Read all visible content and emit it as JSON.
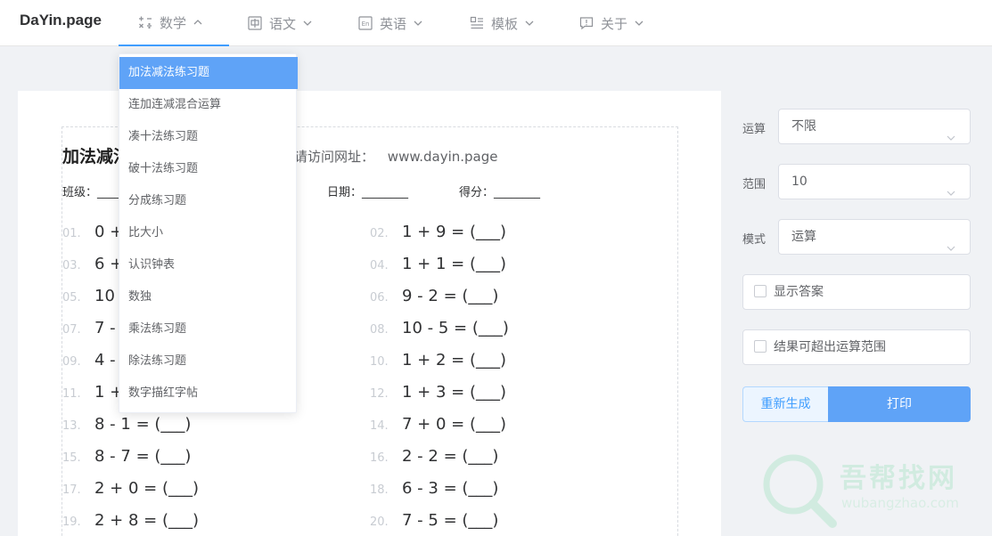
{
  "brand": "DaYin.page",
  "nav": [
    {
      "label": "数学",
      "icon": "math-ops-icon"
    },
    {
      "label": "语文",
      "icon": "chinese-char-icon"
    },
    {
      "label": "英语",
      "icon": "english-icon"
    },
    {
      "label": "模板",
      "icon": "template-icon"
    },
    {
      "label": "关于",
      "icon": "about-icon"
    }
  ],
  "dropdown": [
    "加法减法练习题",
    "连加连减混合运算",
    "凑十法练习题",
    "破十法练习题",
    "分成练习题",
    "比大小",
    "认识钟表",
    "数独",
    "乘法练习题",
    "除法练习题",
    "数字描红字帖"
  ],
  "sheet": {
    "title": "加法减法",
    "visit_label": "请访问网址：",
    "visit_url": "www.dayin.page",
    "class_label": "班级：____",
    "date_label": "日期：________",
    "score_label": "得分：________"
  },
  "questions_left": [
    {
      "num": "01.",
      "text": "0 +"
    },
    {
      "num": "03.",
      "text": "6 +"
    },
    {
      "num": "05.",
      "text": "10"
    },
    {
      "num": "07.",
      "text": "7 -"
    },
    {
      "num": "09.",
      "text": "4 -"
    },
    {
      "num": "11.",
      "text": "1 +"
    },
    {
      "num": "13.",
      "text": "8 - 1 = (___)"
    },
    {
      "num": "15.",
      "text": "8 - 7 = (___)"
    },
    {
      "num": "17.",
      "text": "2 + 0 = (___)"
    },
    {
      "num": "19.",
      "text": "2 + 8 = (___)"
    }
  ],
  "questions_right": [
    {
      "num": "02.",
      "text": "1 + 9 = (___)"
    },
    {
      "num": "04.",
      "text": "1 + 1 = (___)"
    },
    {
      "num": "06.",
      "text": "9 - 2 = (___)"
    },
    {
      "num": "08.",
      "text": "10 - 5 = (___)"
    },
    {
      "num": "10.",
      "text": "1 + 2 = (___)"
    },
    {
      "num": "12.",
      "text": "1 + 3 = (___)"
    },
    {
      "num": "14.",
      "text": "7 + 0 = (___)"
    },
    {
      "num": "16.",
      "text": "2 - 2 = (___)"
    },
    {
      "num": "18.",
      "text": "6 - 3 = (___)"
    },
    {
      "num": "20.",
      "text": "7 - 5 = (___)"
    }
  ],
  "settings": {
    "operation_label": "运算",
    "operation_value": "不限",
    "range_label": "范围",
    "range_value": "10",
    "mode_label": "模式",
    "mode_value": "运算",
    "show_answer": "显示答案",
    "allow_exceed": "结果可超出运算范围",
    "regen_button": "重新生成",
    "print_button": "打印"
  },
  "watermark": {
    "title": "吾帮找网",
    "sub": "wubangzhao.com"
  },
  "colors": {
    "accent": "#409eff",
    "menu_active": "#5fa3f7",
    "watermark": "#b9e7cf"
  }
}
